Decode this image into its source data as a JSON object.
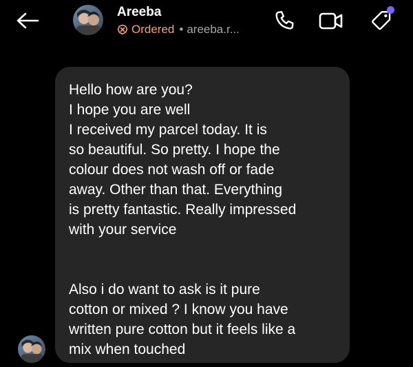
{
  "header": {
    "contact_name": "Areeba",
    "status_label": "Ordered",
    "separator": "•",
    "username": "areeba.r...",
    "icons": {
      "back": "back-arrow-icon",
      "ordered": "ordered-status-icon",
      "call": "phone-icon",
      "video": "video-camera-icon",
      "tag": "price-tag-icon"
    }
  },
  "colors": {
    "background": "#000000",
    "bubble": "#262626",
    "ordered_accent": "#f0a085",
    "muted_text": "#a6a6a6",
    "notification_dot": "#7b61ff"
  },
  "messages": [
    {
      "sender": "Areeba",
      "direction": "incoming",
      "text": "Hello how are you?\nI hope you are well\nI received my parcel today. It is\nso beautiful. So pretty. I hope the\ncolour does not wash off or fade\naway. Other than that. Everything\nis pretty fantastic. Really impressed\nwith your service\n\n\nAlso i do want to ask is it pure\ncotton or mixed ? I know you have\nwritten pure cotton but it feels like a\nmix when touched"
    }
  ]
}
